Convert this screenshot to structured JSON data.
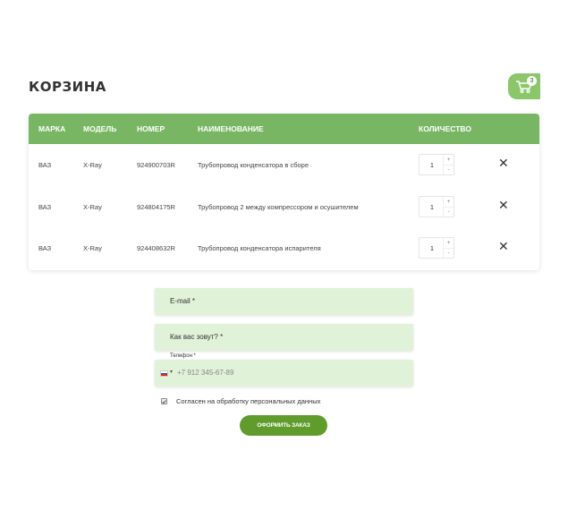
{
  "page": {
    "title": "КОРЗИНА"
  },
  "cart_button": {
    "count": "3",
    "icon": "cart-icon",
    "color": "#8cc66b"
  },
  "table": {
    "header_color": "#78b663",
    "columns": {
      "brand": "МАРКА",
      "model": "МОДЕЛЬ",
      "number": "НОМЕР",
      "name": "НАИМЕНОВАНИЕ",
      "quantity": "КОЛИЧЕСТВО"
    },
    "rows": [
      {
        "brand": "ВАЗ",
        "model": "X-Ray",
        "number": "924900703R",
        "name": "Трубопровод конденсатора в сборе",
        "quantity": "1"
      },
      {
        "brand": "ВАЗ",
        "model": "X-Ray",
        "number": "924804175R",
        "name": "Трубопровод 2 между компрессором и осушителем",
        "quantity": "1"
      },
      {
        "brand": "ВАЗ",
        "model": "X-Ray",
        "number": "924408632R",
        "name": "Трубопровод конденсатора испарителя",
        "quantity": "1"
      }
    ],
    "qty_plus": "+",
    "qty_minus": "-",
    "remove_symbol": "✕"
  },
  "form": {
    "email_placeholder": "E-mail *",
    "name_placeholder": "Как вас зовут? *",
    "phone_label": "Телефон *",
    "phone_placeholder": "+7 912 345-67-89",
    "phone_country_arrow": "▾",
    "consent_text": "Согласен на обработку персональных данных",
    "consent_checked": true,
    "submit_label": "ОФОРМИТЬ ЗАКАЗ",
    "field_color": "#e0f2d8",
    "submit_color": "#5f9c2c"
  }
}
